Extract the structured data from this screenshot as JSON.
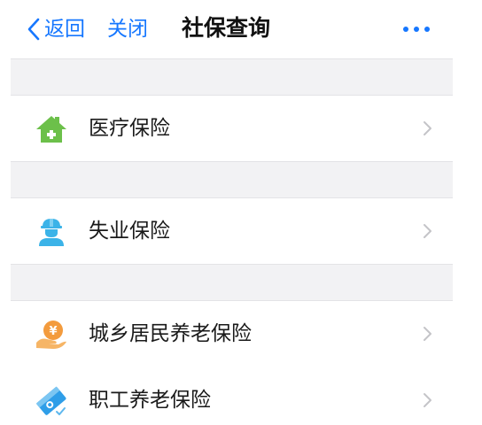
{
  "header": {
    "back_label": "返回",
    "close_label": "关闭",
    "title": "社保查询",
    "more_icon": "more-dots-icon",
    "accent_color": "#1677ff"
  },
  "list": {
    "items": [
      {
        "label": "医疗保险",
        "icon": "house-icon",
        "icon_color": "#6cc04a"
      },
      {
        "label": "失业保险",
        "icon": "worker-icon",
        "icon_color": "#3bb3e8"
      },
      {
        "label": "城乡居民养老保险",
        "icon": "hand-yuan-icon",
        "icon_color": "#f39b3d"
      },
      {
        "label": "职工养老保险",
        "icon": "card-icon",
        "icon_color": "#2f9ee8"
      }
    ]
  }
}
